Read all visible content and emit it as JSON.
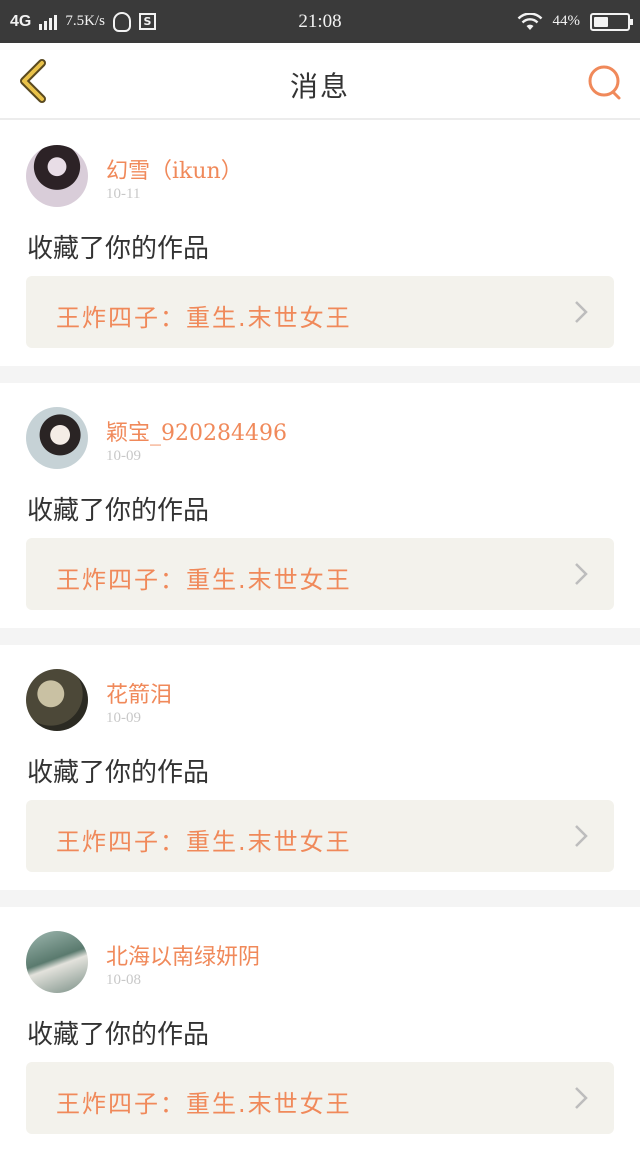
{
  "status_bar": {
    "network": "4G",
    "speed": "7.5K/s",
    "s_badge": "S",
    "time": "21:08",
    "battery_percent": "44%",
    "battery_level": 0.44
  },
  "header": {
    "title": "消息",
    "back_icon": "chevron-left-icon",
    "search_icon": "search-icon"
  },
  "colors": {
    "accent": "#f0895a",
    "back_arrow": "#e9c24a"
  },
  "messages": [
    {
      "username": "幻雪（ikun）",
      "date": "10-11",
      "action": "收藏了你的作品",
      "work_title": "王炸四子：重生.末世女王"
    },
    {
      "username": "颖宝_920284496",
      "date": "10-09",
      "action": "收藏了你的作品",
      "work_title": "王炸四子：重生.末世女王"
    },
    {
      "username": "花箭泪",
      "date": "10-09",
      "action": "收藏了你的作品",
      "work_title": "王炸四子：重生.末世女王"
    },
    {
      "username": "北海以南绿妍阴",
      "date": "10-08",
      "action": "收藏了你的作品",
      "work_title": "王炸四子：重生.末世女王"
    }
  ]
}
